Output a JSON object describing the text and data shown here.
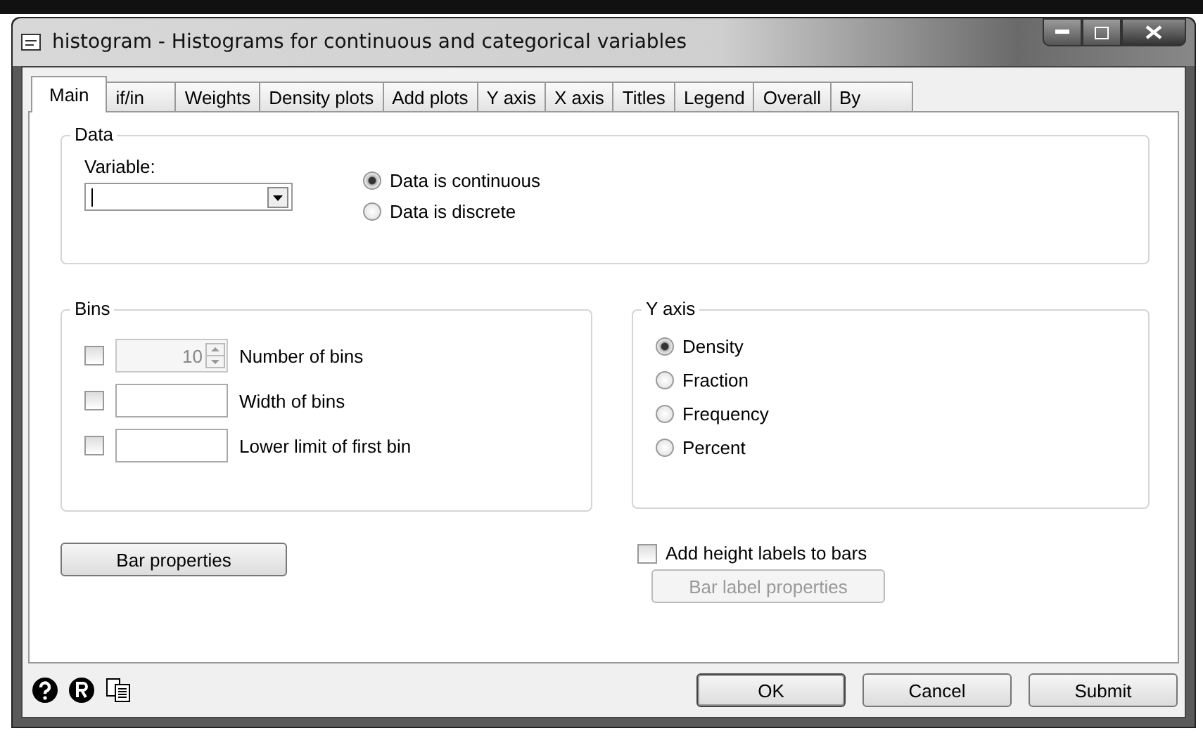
{
  "window": {
    "title": "histogram - Histograms for continuous and categorical variables"
  },
  "tabs": [
    {
      "label": "Main",
      "selected": true
    },
    {
      "label": "if/in",
      "selected": false
    },
    {
      "label": "Weights",
      "selected": false
    },
    {
      "label": "Density plots",
      "selected": false
    },
    {
      "label": "Add plots",
      "selected": false
    },
    {
      "label": "Y axis",
      "selected": false
    },
    {
      "label": "X axis",
      "selected": false
    },
    {
      "label": "Titles",
      "selected": false
    },
    {
      "label": "Legend",
      "selected": false
    },
    {
      "label": "Overall",
      "selected": false
    },
    {
      "label": "By",
      "selected": false
    }
  ],
  "data_group": {
    "title": "Data",
    "variable_label": "Variable:",
    "options": [
      {
        "label": "Data is continuous",
        "selected": true
      },
      {
        "label": "Data is discrete",
        "selected": false
      }
    ]
  },
  "bins_group": {
    "title": "Bins",
    "rows": [
      {
        "kind": "spinner",
        "checked": false,
        "disabled": true,
        "value": "10",
        "label": "Number of bins"
      },
      {
        "kind": "text",
        "checked": false,
        "disabled": false,
        "label": "Width of bins"
      },
      {
        "kind": "text",
        "checked": false,
        "disabled": false,
        "label": "Lower limit of first bin"
      }
    ]
  },
  "y_axis_group": {
    "title": "Y axis",
    "options": [
      {
        "label": "Density",
        "selected": true
      },
      {
        "label": "Fraction",
        "selected": false
      },
      {
        "label": "Frequency",
        "selected": false
      },
      {
        "label": "Percent",
        "selected": false
      }
    ]
  },
  "bar_properties": {
    "label": "Bar properties",
    "disabled": false
  },
  "height_labels": {
    "label": "Add height labels to bars",
    "checked": false
  },
  "bar_label_properties": {
    "label": "Bar label properties",
    "disabled": true
  },
  "footer_buttons": [
    {
      "label": "OK",
      "default": true
    },
    {
      "label": "Cancel",
      "default": false
    },
    {
      "label": "Submit",
      "default": false
    }
  ]
}
